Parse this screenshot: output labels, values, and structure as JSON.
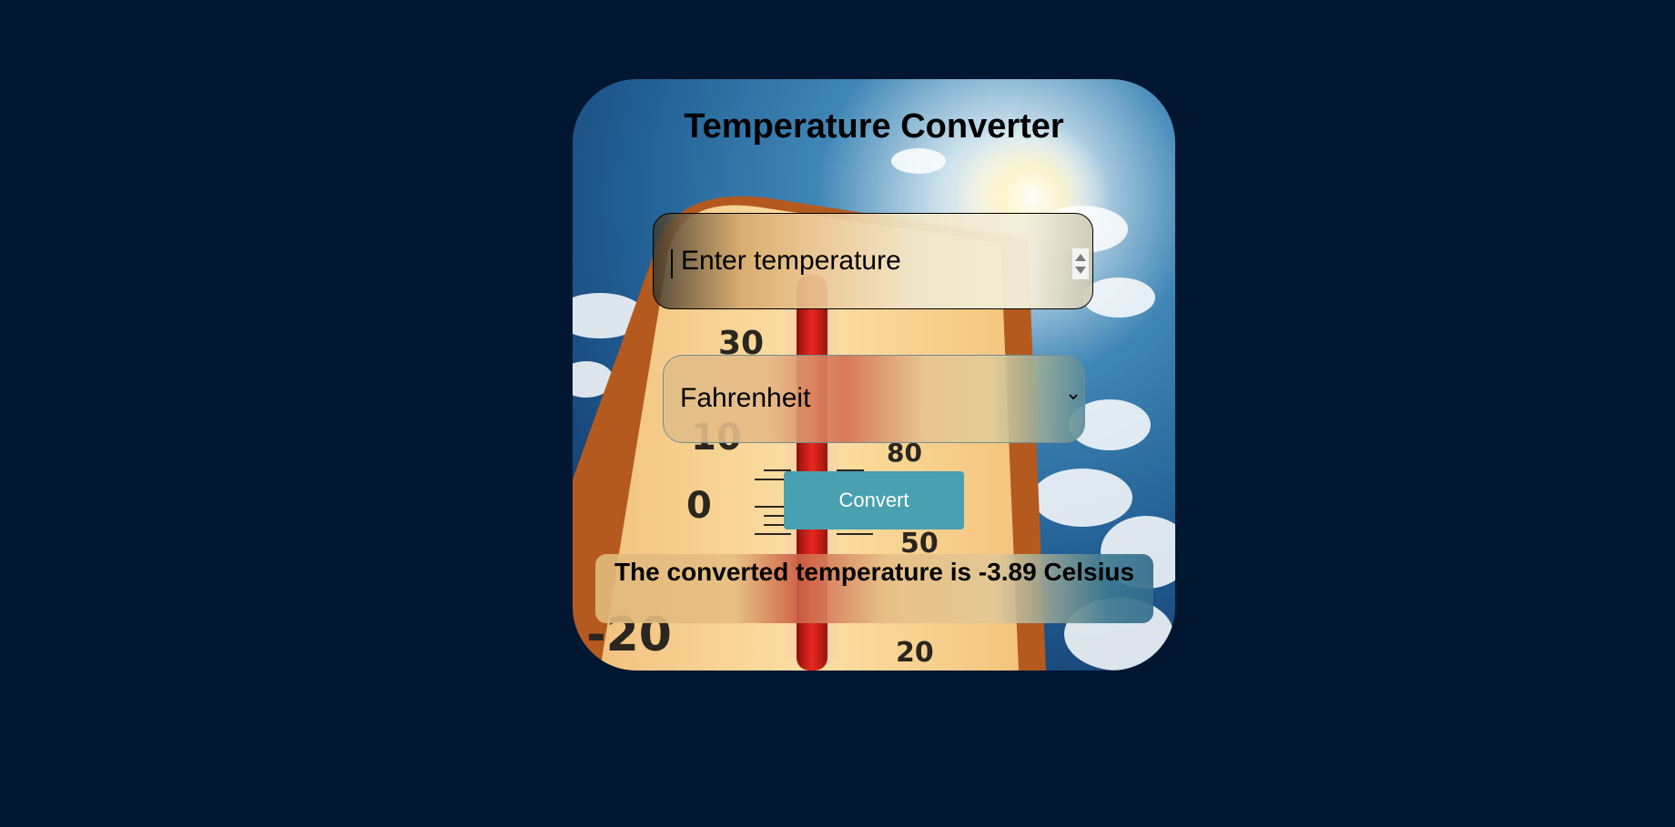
{
  "app": {
    "title": "Temperature Converter"
  },
  "form": {
    "temperature_input": {
      "value": "",
      "placeholder": "Enter temperature"
    },
    "unit_select": {
      "selected": "Fahrenheit"
    },
    "convert_label": "Convert"
  },
  "result": {
    "text": "The converted temperature is -3.89 Celsius"
  },
  "colors": {
    "page_background": "#001631",
    "button_background": "#49a0b0",
    "button_text": "#ffffff"
  },
  "icons": {
    "number_spinner": "spinner-arrows-icon",
    "select_arrow": "chevron-down-icon",
    "background_image": "thermometer-sky-illustration"
  }
}
